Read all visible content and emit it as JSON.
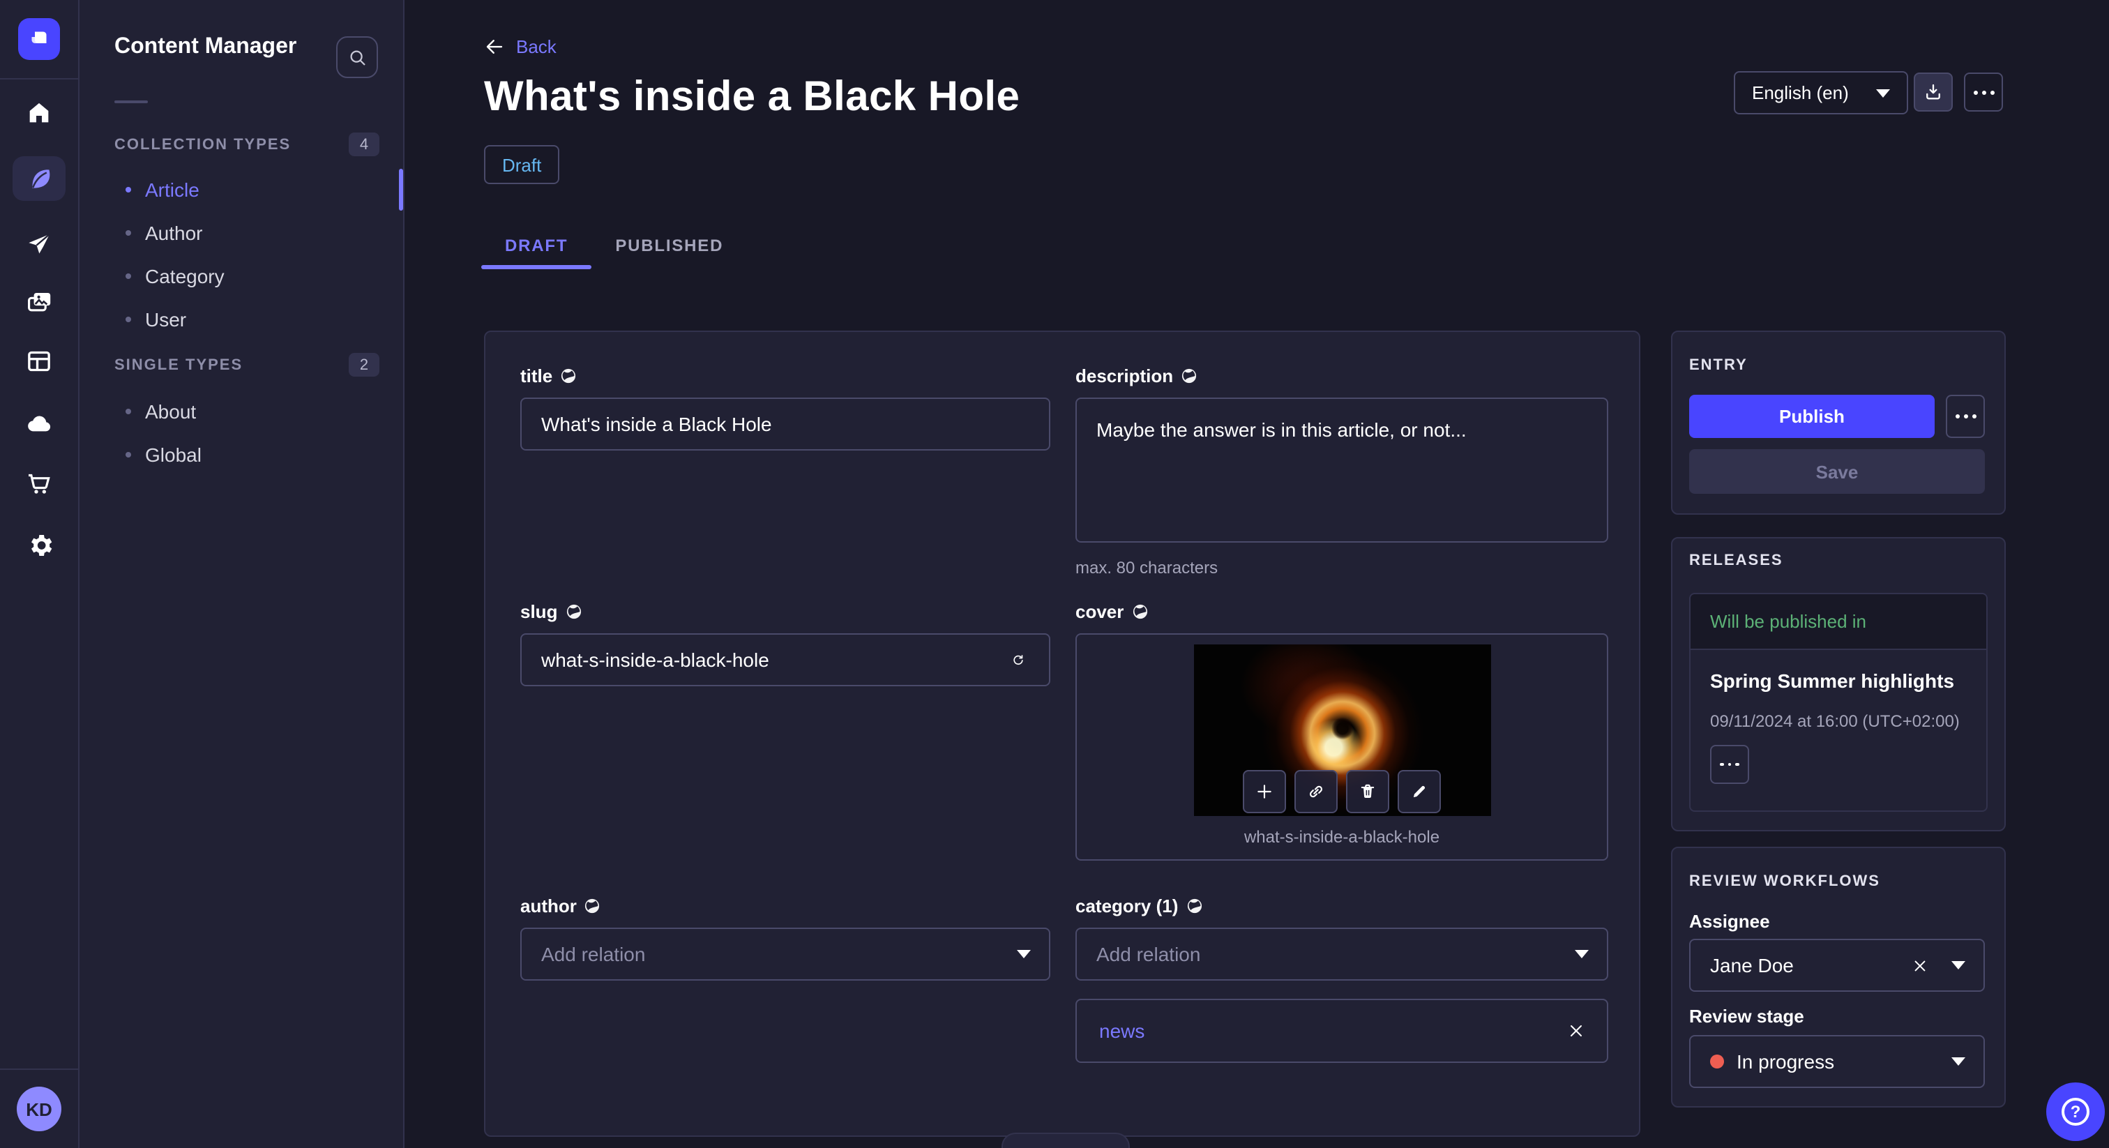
{
  "colors": {
    "app_bg": "#181826",
    "surface": "#212134",
    "border": "#32324d",
    "input_border": "#4a4a6a",
    "primary": "#4945ff",
    "primary_light": "#7b79ff",
    "lilac": "#8e8aff",
    "draft_blue": "#66b7f1",
    "success_green": "#5cb176",
    "stage_red": "#ee5e52",
    "text_muted": "#a5a5ba"
  },
  "nav": {
    "avatar_initials": "KD"
  },
  "subnav": {
    "title": "Content Manager",
    "sections": [
      {
        "label": "COLLECTION TYPES",
        "count": "4",
        "items": [
          {
            "label": "Article"
          },
          {
            "label": "Author"
          },
          {
            "label": "Category"
          },
          {
            "label": "User"
          }
        ]
      },
      {
        "label": "SINGLE TYPES",
        "count": "2",
        "items": [
          {
            "label": "About"
          },
          {
            "label": "Global"
          }
        ]
      }
    ]
  },
  "header": {
    "back_label": "Back",
    "title": "What's inside a Black Hole",
    "status_badge": "Draft",
    "tabs": [
      {
        "label": "DRAFT"
      },
      {
        "label": "PUBLISHED"
      }
    ],
    "locale_value": "English (en)"
  },
  "form": {
    "title": {
      "label": "title",
      "value": "What's inside a Black Hole"
    },
    "description": {
      "label": "description",
      "value": "Maybe the answer is in this article, or not...",
      "hint": "max. 80 characters"
    },
    "slug": {
      "label": "slug",
      "value": "what-s-inside-a-black-hole"
    },
    "cover": {
      "label": "cover",
      "filename": "what-s-inside-a-black-hole"
    },
    "author": {
      "label": "author",
      "placeholder": "Add relation"
    },
    "category": {
      "label": "category (1)",
      "placeholder": "Add relation",
      "selected_tag": "news"
    }
  },
  "entry_panel": {
    "caption": "ENTRY",
    "publish_label": "Publish",
    "save_label": "Save"
  },
  "releases_panel": {
    "caption": "RELEASES",
    "status": "Will be published in",
    "release_name": "Spring Summer highlights",
    "release_date": "09/11/2024 at 16:00 (UTC+02:00)"
  },
  "review_panel": {
    "caption": "REVIEW WORKFLOWS",
    "assignee_label": "Assignee",
    "assignee_value": "Jane Doe",
    "stage_label": "Review stage",
    "stage_value": "In progress"
  }
}
